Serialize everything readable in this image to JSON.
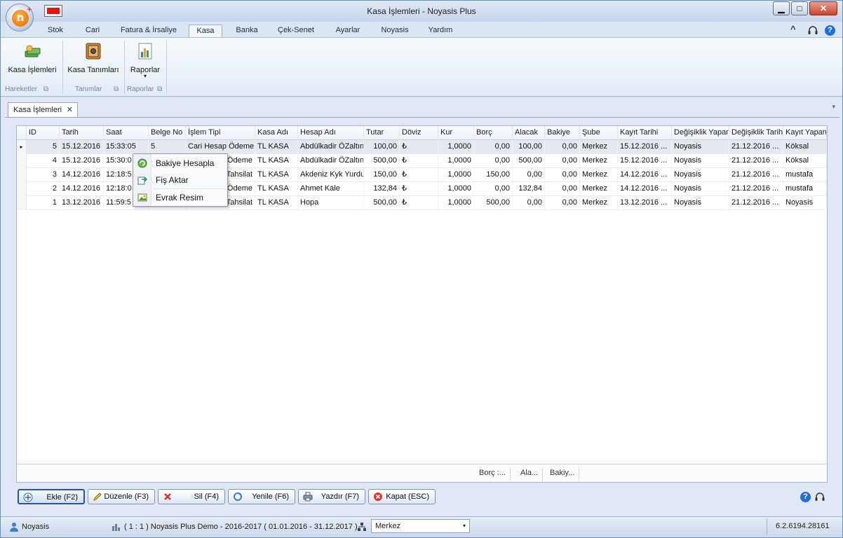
{
  "window": {
    "title": "Kasa İşlemleri - Noyasis Plus",
    "buttons": {
      "minimize": "▁",
      "maximize": "□",
      "close": "✕"
    }
  },
  "app": {
    "orb_letter": "n",
    "orb_plus": "+"
  },
  "ribbon": {
    "tabs": [
      {
        "label": "Stok"
      },
      {
        "label": "Cari"
      },
      {
        "label": "Fatura & İrsaliye"
      },
      {
        "label": "Kasa",
        "active": true
      },
      {
        "label": "Banka"
      },
      {
        "label": "Çek-Senet"
      },
      {
        "label": "Ayarlar"
      },
      {
        "label": "Noyasis"
      },
      {
        "label": "Yardım"
      }
    ],
    "right_icons": {
      "collapse": "^",
      "help": "?"
    },
    "buttons": [
      {
        "label": "Kasa İşlemleri",
        "icon": "money-stack-icon"
      },
      {
        "label": "Kasa Tanımları",
        "icon": "safe-icon"
      },
      {
        "label": "Raporlar",
        "icon": "report-chart-icon",
        "dropdown": "▾"
      }
    ],
    "groups": [
      {
        "label": "Hareketler"
      },
      {
        "label": "Tanımlar"
      },
      {
        "label": "Raporlar"
      }
    ],
    "group_launcher": "⧉"
  },
  "document_tab": {
    "label": "Kasa İşlemleri",
    "close": "✕",
    "overflow": "▾"
  },
  "grid": {
    "columns": [
      "ID",
      "Tarih",
      "Saat",
      "Belge No",
      "İşlem Tipi",
      "Kasa Adı",
      "Hesap Adı",
      "Tutar",
      "Döviz",
      "Kur",
      "Borç",
      "Alacak",
      "Bakiye",
      "Şube",
      "Kayıt Tarihi",
      "Değişiklik Yapan",
      "Değişiklik Tarihi",
      "Kayıt Yapan"
    ],
    "row_indicator": "▸",
    "rows": [
      {
        "id": "5",
        "tarih": "15.12.2016",
        "saat": "15:33:05",
        "belge": "5",
        "tip": "Cari Hesap Ödeme",
        "kasa": "TL KASA",
        "hesap": "Abdülkadir ÖZaltın",
        "tutar": "100,00",
        "doviz": "₺",
        "kur": "1,0000",
        "borc": "0,00",
        "alacak": "100,00",
        "bakiye": "0,00",
        "sube": "Merkez",
        "kayit_tarihi": "15.12.2016 ...",
        "degisiklik_yapan": "Noyasis",
        "degisiklik_tarihi": "21.12.2016 ...",
        "kayit_yapan": "Köksal"
      },
      {
        "id": "4",
        "tarih": "15.12.2016",
        "saat": "15:30:0",
        "belge": "",
        "tip": "Ödeme",
        "kasa": "TL KASA",
        "hesap": "Abdülkadir ÖZaltın",
        "tutar": "500,00",
        "doviz": "₺",
        "kur": "1,0000",
        "borc": "0,00",
        "alacak": "500,00",
        "bakiye": "0,00",
        "sube": "Merkez",
        "kayit_tarihi": "15.12.2016 ...",
        "degisiklik_yapan": "Noyasis",
        "degisiklik_tarihi": "21.12.2016 ...",
        "kayit_yapan": "Köksal"
      },
      {
        "id": "3",
        "tarih": "14.12.2016",
        "saat": "12:18:5",
        "belge": "",
        "tip": "Tahsilat",
        "kasa": "TL KASA",
        "hesap": "Akdeniz Kyk Yurdu",
        "tutar": "150,00",
        "doviz": "₺",
        "kur": "1,0000",
        "borc": "150,00",
        "alacak": "0,00",
        "bakiye": "0,00",
        "sube": "Merkez",
        "kayit_tarihi": "14.12.2016 ...",
        "degisiklik_yapan": "Noyasis",
        "degisiklik_tarihi": "21.12.2016 ...",
        "kayit_yapan": "mustafa"
      },
      {
        "id": "2",
        "tarih": "14.12.2016",
        "saat": "12:18:0",
        "belge": "",
        "tip": "Ödeme",
        "kasa": "TL KASA",
        "hesap": "Ahmet Kale",
        "tutar": "132,84",
        "doviz": "₺",
        "kur": "1,0000",
        "borc": "0,00",
        "alacak": "132,84",
        "bakiye": "0,00",
        "sube": "Merkez",
        "kayit_tarihi": "14.12.2016 ...",
        "degisiklik_yapan": "Noyasis",
        "degisiklik_tarihi": "21.12.2016 ...",
        "kayit_yapan": "mustafa"
      },
      {
        "id": "1",
        "tarih": "13.12.2016",
        "saat": "11:59:5",
        "belge": "",
        "tip": "Tahsilat",
        "kasa": "TL KASA",
        "hesap": "Hopa",
        "tutar": "500,00",
        "doviz": "₺",
        "kur": "1,0000",
        "borc": "500,00",
        "alacak": "0,00",
        "bakiye": "0,00",
        "sube": "Merkez",
        "kayit_tarihi": "13.12.2016 ...",
        "degisiklik_yapan": "Noyasis",
        "degisiklik_tarihi": "21.12.2016 ...",
        "kayit_yapan": "Noyasis"
      }
    ],
    "footer": {
      "borc": "Borç :...",
      "alacak": "Ala...",
      "bakiye": "Bakiy..."
    }
  },
  "context_menu": {
    "items": [
      {
        "label": "Bakiye Hesapla",
        "icon": "refresh-calc-icon"
      },
      {
        "label": "Fiş Aktar",
        "icon": "export-document-icon"
      },
      {
        "label": "Evrak Resim",
        "icon": "image-icon"
      }
    ]
  },
  "actions": [
    {
      "label": "Ekle (F2)",
      "icon": "add-icon"
    },
    {
      "label": "Düzenle (F3)",
      "icon": "edit-pencil-icon"
    },
    {
      "label": "Sil (F4)",
      "icon": "delete-x-icon"
    },
    {
      "label": "Yenile (F6)",
      "icon": "refresh-icon"
    },
    {
      "label": "Yazdır (F7)",
      "icon": "printer-icon"
    },
    {
      "label": "Kapat (ESC)",
      "icon": "close-circle-icon"
    }
  ],
  "status": {
    "user": "Noyasis",
    "company": "( 1 : 1 ) Noyasis Plus Demo - 2016-2017 ( 01.01.2016 - 31.12.2017 )",
    "branch": "Merkez",
    "branch_caret": "▾",
    "version": "6.2.6194.28161"
  },
  "colors": {
    "accent": "#2456a7",
    "selected_row": "#e4e9f0",
    "close_red": "#c7432d"
  }
}
